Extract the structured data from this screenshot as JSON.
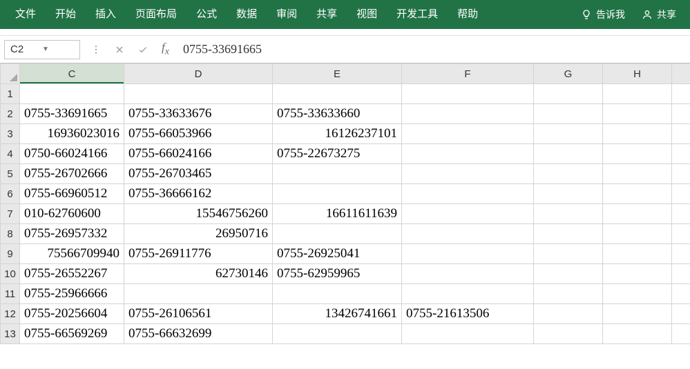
{
  "ribbon": {
    "tabs": [
      "文件",
      "开始",
      "插入",
      "页面布局",
      "公式",
      "数据",
      "审阅",
      "共享",
      "视图",
      "开发工具",
      "帮助"
    ],
    "tell_me": "告诉我",
    "share": "共享"
  },
  "formula_bar": {
    "name_box": "C2",
    "formula": "0755-33691665"
  },
  "columns": [
    "C",
    "D",
    "E",
    "F",
    "G",
    "H"
  ],
  "rows": [
    {
      "n": 1,
      "C": "",
      "D": "",
      "E": "",
      "F": ""
    },
    {
      "n": 2,
      "C": "0755-33691665",
      "D": "0755-33633676",
      "E": "0755-33633660",
      "F": ""
    },
    {
      "n": 3,
      "C": 16936023016,
      "D": "0755-66053966",
      "E": 16126237101,
      "F": ""
    },
    {
      "n": 4,
      "C": "0750-66024166",
      "D": "0755-66024166",
      "E": "0755-22673275",
      "F": ""
    },
    {
      "n": 5,
      "C": "0755-26702666",
      "D": "0755-26703465",
      "E": "",
      "F": ""
    },
    {
      "n": 6,
      "C": "0755-66960512",
      "D": "0755-36666162",
      "E": "",
      "F": ""
    },
    {
      "n": 7,
      "C": "010-62760600",
      "D": 15546756260,
      "E": 16611611639,
      "F": ""
    },
    {
      "n": 8,
      "C": "0755-26957332",
      "D": 26950716,
      "E": "",
      "F": ""
    },
    {
      "n": 9,
      "C": 75566709940,
      "D": "0755-26911776",
      "E": "0755-26925041",
      "F": ""
    },
    {
      "n": 10,
      "C": "0755-26552267",
      "D": 62730146,
      "E": "0755-62959965",
      "F": ""
    },
    {
      "n": 11,
      "C": "0755-25966666",
      "D": "",
      "E": "",
      "F": ""
    },
    {
      "n": 12,
      "C": "0755-20256604",
      "D": "0755-26106561",
      "E": 13426741661,
      "F": "0755-21613506"
    },
    {
      "n": 13,
      "C": "0755-66569269",
      "D": "0755-66632699",
      "E": "",
      "F": ""
    }
  ],
  "selected_cell": "C2"
}
